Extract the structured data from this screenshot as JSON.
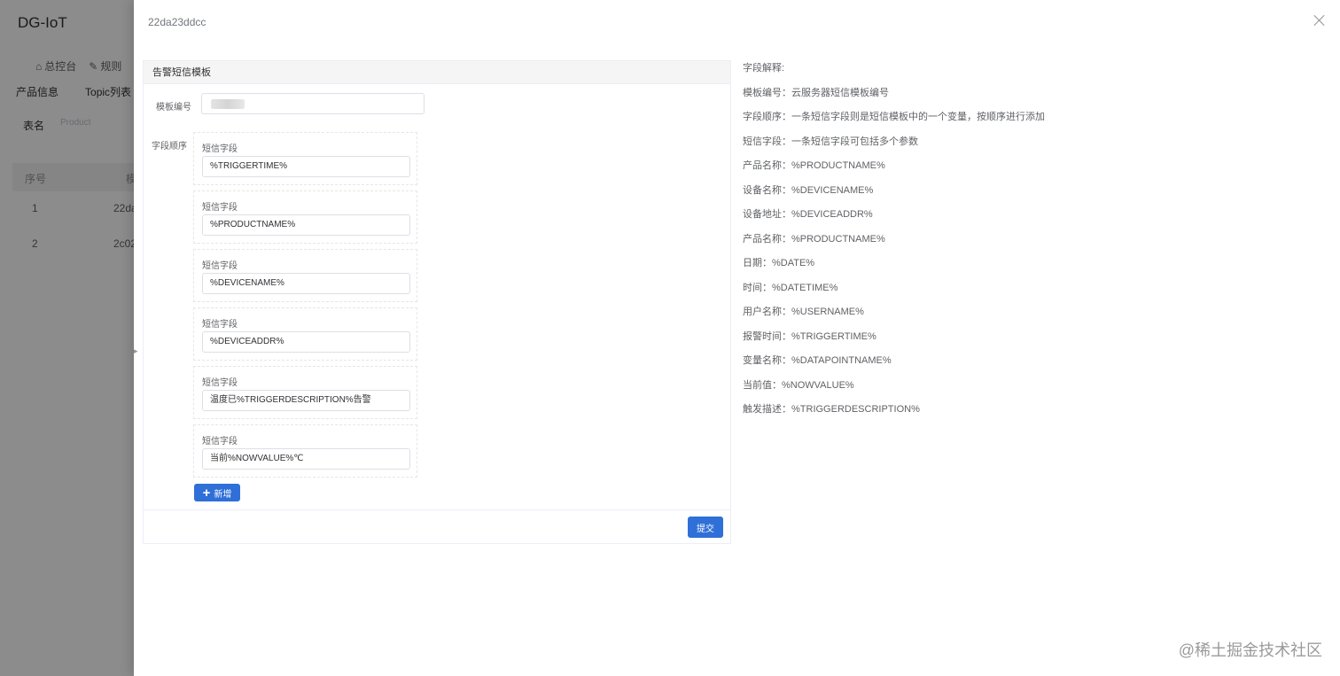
{
  "background": {
    "app_title": "DG-IoT",
    "nav": [
      {
        "icon": "home-icon",
        "label": "总控台"
      },
      {
        "icon": "edit-icon",
        "label": "规则"
      }
    ],
    "tabs": [
      "产品信息",
      "Topic列表"
    ],
    "filter": {
      "label": "表名",
      "placeholder": "Product"
    },
    "table": {
      "headers": [
        "序号",
        "模"
      ],
      "rows": [
        {
          "index": "1",
          "name": "22da"
        },
        {
          "index": "2",
          "name": "2c02"
        }
      ]
    }
  },
  "drawer": {
    "title": "22da23ddcc",
    "card_title": "告警短信模板",
    "template_label": "模板编号",
    "template_value": "",
    "order_label": "字段顺序",
    "fields": [
      {
        "label": "短信字段",
        "value": "%TRIGGERTIME%"
      },
      {
        "label": "短信字段",
        "value": "%PRODUCTNAME%"
      },
      {
        "label": "短信字段",
        "value": "%DEVICENAME%"
      },
      {
        "label": "短信字段",
        "value": "%DEVICEADDR%"
      },
      {
        "label": "短信字段",
        "value": "温度已%TRIGGERDESCRIPTION%告警"
      },
      {
        "label": "短信字段",
        "value": "当前%NOWVALUE%℃"
      }
    ],
    "add_label": "新增",
    "submit_label": "提交"
  },
  "explanation": [
    "字段解释:",
    "模板编号：云服务器短信模板编号",
    "字段顺序：一条短信字段则是短信模板中的一个变量，按顺序进行添加",
    "短信字段：一条短信字段可包括多个参数",
    "产品名称：%PRODUCTNAME%",
    "设备名称：%DEVICENAME%",
    "设备地址：%DEVICEADDR%",
    "产品名称：%PRODUCTNAME%",
    "日期：%DATE%",
    "时间：%DATETIME%",
    "用户名称：%USERNAME%",
    "报警时间：%TRIGGERTIME%",
    "变量名称：%DATAPOINTNAME%",
    "当前值：%NOWVALUE%",
    "触发描述：%TRIGGERDESCRIPTION%"
  ],
  "watermark": "@稀土掘金技术社区"
}
